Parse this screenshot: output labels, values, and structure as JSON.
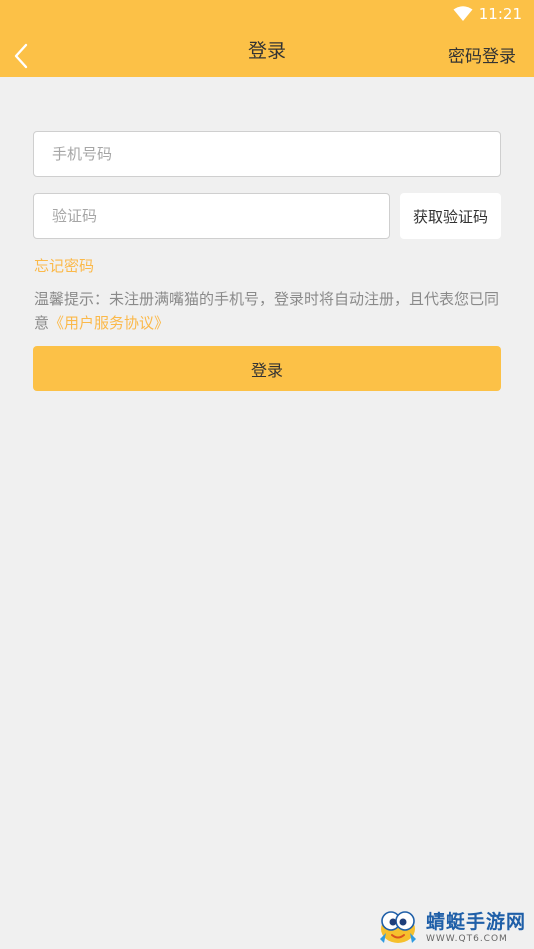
{
  "status_bar": {
    "time": "11:21"
  },
  "app_bar": {
    "title": "登录",
    "password_login": "密码登录"
  },
  "form": {
    "phone": {
      "value": "",
      "placeholder": "手机号码"
    },
    "code": {
      "value": "",
      "placeholder": "验证码"
    },
    "get_code_label": "获取验证码",
    "forgot_label": "忘记密码",
    "tip_text": "温馨提示：未注册满嘴猫的手机号，登录时将自动注册，且代表您已同意",
    "agreement_link": "《用户服务协议》",
    "login_label": "登录"
  },
  "watermark": {
    "title": "蜻蜓手游网",
    "url": "WWW.QT6.COM"
  },
  "colors": {
    "accent": "#fcc147",
    "link": "#fbb94a",
    "background": "#f0f0f0"
  },
  "icons": {
    "back": "chevron-left-icon",
    "wifi": "wifi-icon"
  }
}
